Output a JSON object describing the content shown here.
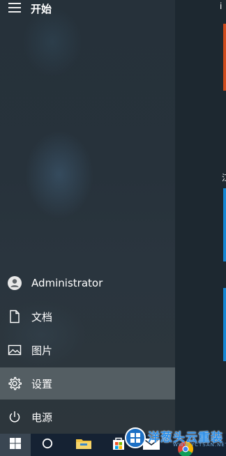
{
  "start_menu": {
    "title": "开始",
    "items": [
      {
        "id": "user",
        "label": "Administrator",
        "icon": "user-icon"
      },
      {
        "id": "documents",
        "label": "文档",
        "icon": "document-icon"
      },
      {
        "id": "pictures",
        "label": "图片",
        "icon": "picture-icon"
      },
      {
        "id": "settings",
        "label": "设置",
        "icon": "gear-icon",
        "active": true
      },
      {
        "id": "power",
        "label": "电源",
        "icon": "power-icon"
      }
    ]
  },
  "tiles": {
    "corner_text": "i",
    "side_text": "江"
  },
  "taskbar": {
    "items": [
      "windows-start-icon",
      "cortana-icon",
      "file-explorer-icon",
      "store-icon",
      "mail-icon",
      "chrome-icon"
    ]
  },
  "watermark": {
    "text": "洋葱头云重装",
    "sub": "WWW.YCTSAN.NET"
  },
  "colors": {
    "tile_orange": "#d04a1c",
    "tile_blue": "#1487d4",
    "taskbar": "#152233"
  }
}
